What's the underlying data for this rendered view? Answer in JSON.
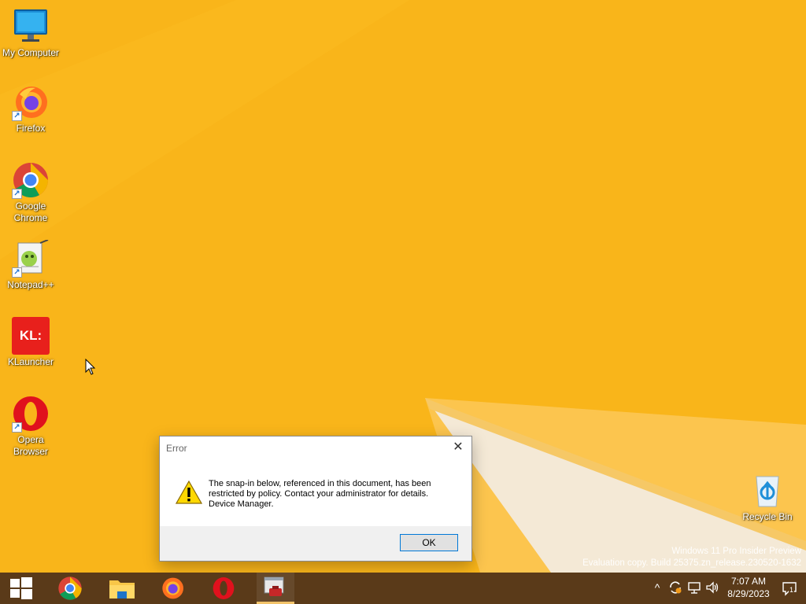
{
  "desktop": {
    "icons": [
      {
        "label": "My Computer",
        "icon": "monitor-icon"
      },
      {
        "label": "Firefox",
        "icon": "firefox-icon"
      },
      {
        "label": "Google Chrome",
        "icon": "chrome-icon"
      },
      {
        "label": "Notepad++",
        "icon": "notepadpp-icon"
      },
      {
        "label": "KLauncher",
        "icon": "klauncher-icon",
        "glyph_text": "KL:"
      },
      {
        "label": "Opera Browser",
        "icon": "opera-icon"
      }
    ],
    "recycle_bin": {
      "label": "Recycle Bin",
      "icon": "recycle-bin-icon"
    },
    "watermark": {
      "line1": "Windows 11 Pro Insider Preview",
      "line2": "Evaluation copy. Build 25375.zn_release.230520-1632"
    }
  },
  "dialog": {
    "title": "Error",
    "message_line1": "The snap-in below, referenced in this document, has been",
    "message_line2": "restricted by policy. Contact your administrator for details.",
    "message_line3": "Device Manager.",
    "ok_label": "OK",
    "icon": "warning-icon"
  },
  "taskbar": {
    "items": [
      {
        "name": "start",
        "icon": "windows-logo-icon"
      },
      {
        "name": "chrome",
        "icon": "chrome-icon"
      },
      {
        "name": "file-explorer",
        "icon": "folder-icon"
      },
      {
        "name": "firefox",
        "icon": "firefox-icon"
      },
      {
        "name": "opera",
        "icon": "opera-icon"
      },
      {
        "name": "mmc",
        "icon": "management-console-icon",
        "active": true
      }
    ],
    "tray": {
      "time": "7:07 AM",
      "date": "8/29/2023",
      "notification_count": "1"
    }
  },
  "colors": {
    "desktop_bg": "#f9b51a",
    "taskbar_bg": "#5a3a19",
    "accent": "#0078d7"
  }
}
